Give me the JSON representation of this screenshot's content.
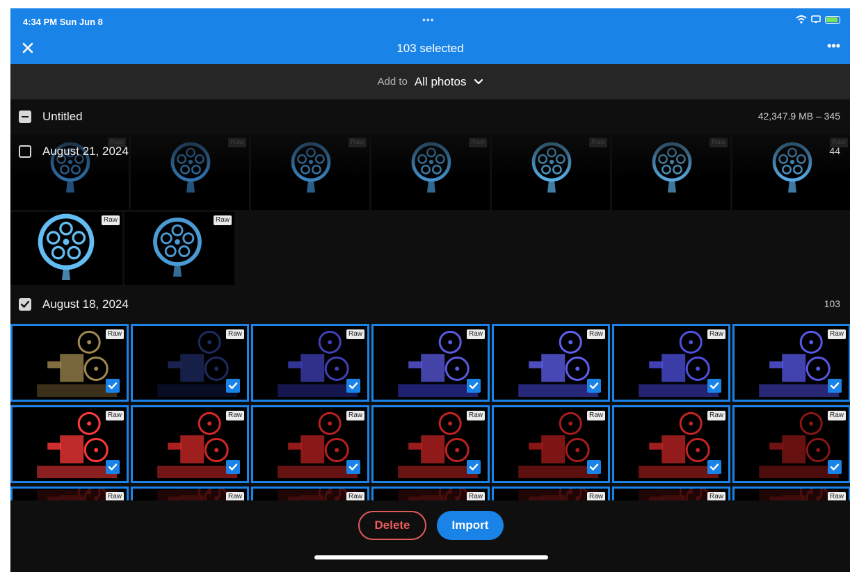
{
  "status": {
    "time_date": "4:34 PM  Sun Jun 8",
    "dots": "•••"
  },
  "header": {
    "title": "103 selected",
    "more": "•••"
  },
  "add_to": {
    "label": "Add to",
    "value": "All photos"
  },
  "sections": [
    {
      "title": "Untitled",
      "meta": "42,347.9 MB – 345",
      "check": "partial"
    },
    {
      "title": "August 21, 2024",
      "meta": "44",
      "check": "unchecked"
    },
    {
      "title": "August 18, 2024",
      "meta": "103",
      "check": "checked"
    }
  ],
  "raw_badge": "Raw",
  "buttons": {
    "delete": "Delete",
    "import": "Import"
  },
  "colors": {
    "accent": "#1a83e8",
    "danger": "#e05a5a",
    "background": "#0f0f0f",
    "toolbar": "#262626"
  },
  "icons": {
    "close": "close-icon",
    "more": "more-icon",
    "chevron": "chevron-down-icon",
    "check": "check-icon",
    "wifi": "wifi-icon",
    "battery": "battery-icon"
  }
}
